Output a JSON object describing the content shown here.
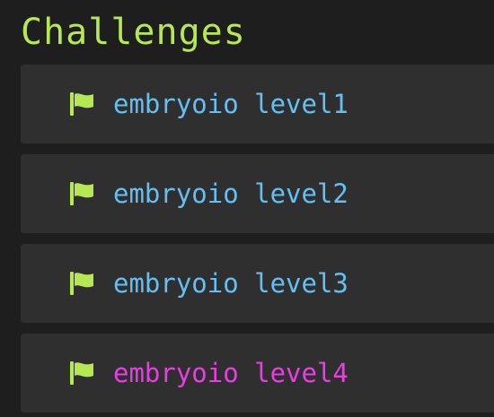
{
  "page": {
    "title": "Challenges"
  },
  "challenges": [
    {
      "label": "embryoio level1",
      "state": "default"
    },
    {
      "label": "embryoio level2",
      "state": "default"
    },
    {
      "label": "embryoio level3",
      "state": "default"
    },
    {
      "label": "embryoio level4",
      "state": "active"
    }
  ],
  "icons": {
    "challenge": "flag-icon"
  },
  "colors": {
    "background": "#1e1e1e",
    "card": "#2f2f2f",
    "title": "#b5e853",
    "flag": "#b5e853",
    "link": "#63c0f5",
    "link_active": "#ea3de5"
  }
}
